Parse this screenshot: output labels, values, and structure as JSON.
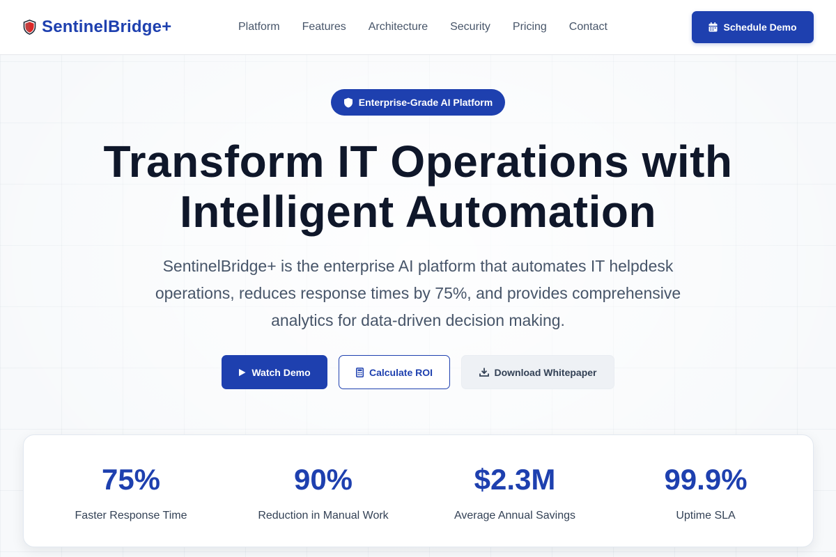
{
  "brand": {
    "name": "SentinelBridge+",
    "logo_icon": "shield-icon"
  },
  "nav": {
    "items": [
      {
        "label": "Platform"
      },
      {
        "label": "Features"
      },
      {
        "label": "Architecture"
      },
      {
        "label": "Security"
      },
      {
        "label": "Pricing"
      },
      {
        "label": "Contact"
      }
    ]
  },
  "header": {
    "cta_label": "Schedule Demo",
    "cta_icon": "calendar-icon"
  },
  "hero": {
    "badge": {
      "label": "Enterprise-Grade AI Platform",
      "icon": "shield-icon"
    },
    "headline_line1": "Transform IT Operations with",
    "headline_line2": "Intelligent Automation",
    "subtext": "SentinelBridge+ is the enterprise AI platform that automates IT helpdesk operations, reduces response times by 75%, and provides comprehensive analytics for data-driven decision making.",
    "buttons": {
      "watch_demo": {
        "label": "Watch Demo",
        "icon": "play-icon"
      },
      "calculate_roi": {
        "label": "Calculate ROI",
        "icon": "calculator-icon"
      },
      "download_whitepaper": {
        "label": "Download Whitepaper",
        "icon": "download-icon"
      }
    }
  },
  "stats": [
    {
      "value": "75%",
      "label": "Faster Response Time"
    },
    {
      "value": "90%",
      "label": "Reduction in Manual Work"
    },
    {
      "value": "$2.3M",
      "label": "Average Annual Savings"
    },
    {
      "value": "99.9%",
      "label": "Uptime SLA"
    }
  ],
  "colors": {
    "primary": "#1e40af",
    "heading": "#0f172a",
    "body_text": "#475569",
    "logo_red": "#dc2626"
  }
}
